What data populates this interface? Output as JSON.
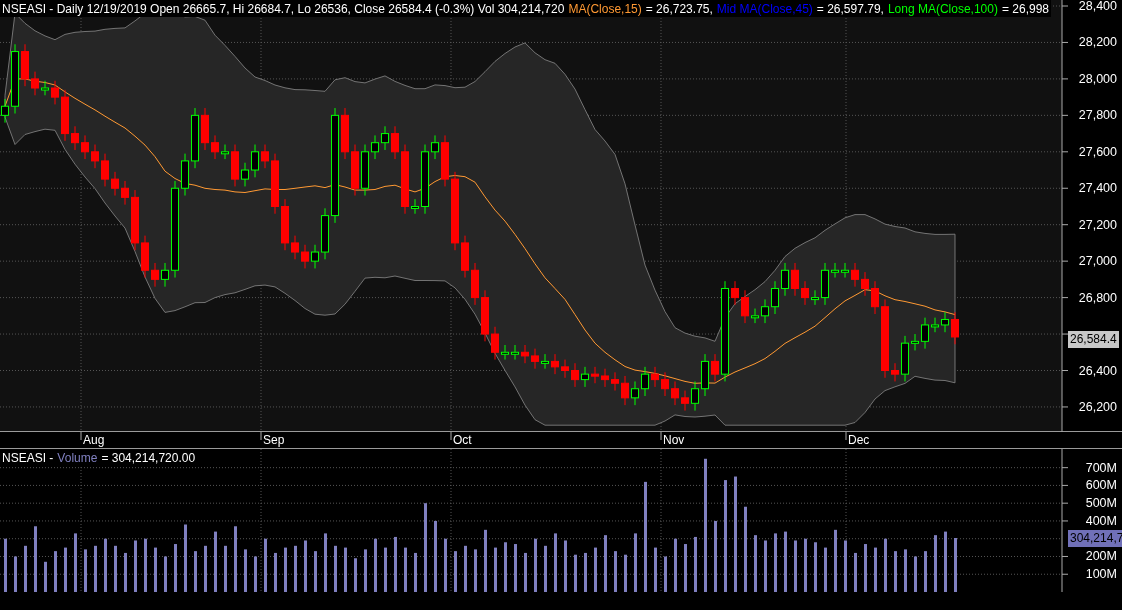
{
  "price_panel": {
    "header": [
      {
        "text": "NSEASI - Daily 12/19/2019 Open 26665.7, Hi 26684.7, Lo 26536, Close 26584.4 (-0.3%) Vol 304,214,720",
        "color": "#ffffff"
      },
      {
        "text": "MA(Close,15)",
        "color": "#ff9933"
      },
      {
        "text": "= 26,723.75,",
        "color": "#ffffff"
      },
      {
        "text": "Mid MA(Close,45)",
        "color": "#0000ff"
      },
      {
        "text": "= 26,597.79,",
        "color": "#ffffff"
      },
      {
        "text": "Long MA(Close,100)",
        "color": "#00ff00"
      },
      {
        "text": "= 26,998",
        "color": "#ffffff"
      }
    ],
    "last_price_tag": "26,584.4",
    "y_axis_labels": [
      "28,400",
      "28,200",
      "28,000",
      "27,800",
      "27,600",
      "27,400",
      "27,200",
      "27,000",
      "26,800",
      "26,400",
      "26,200"
    ],
    "x_axis_labels": [
      "Aug",
      "Sep",
      "Oct",
      "Nov",
      "Dec"
    ]
  },
  "volume_panel": {
    "title_prefix": "NSEASI -",
    "title_value": "= 304,214,720.00",
    "last_volume_tag": "304,214,7",
    "chart_data": {
      "type": "bar",
      "ylim": [
        0,
        760
      ],
      "grid": true,
      "categories": [
        null,
        null,
        null,
        null,
        null,
        null,
        null,
        null,
        null,
        null,
        null,
        null,
        null,
        null,
        null,
        null,
        null,
        null,
        null,
        null,
        null,
        null,
        null,
        null,
        null,
        null,
        null,
        null,
        null,
        null,
        null,
        null,
        null,
        null,
        null,
        null,
        null,
        null,
        null,
        null,
        null,
        null,
        null,
        null,
        null,
        null,
        null,
        null,
        null,
        null,
        null,
        null,
        null,
        null,
        null,
        null,
        null,
        null,
        null,
        null,
        null,
        null,
        null,
        null,
        null,
        null,
        null,
        null,
        null,
        null,
        null,
        null,
        null,
        null,
        null,
        null,
        null,
        null,
        null,
        null,
        null,
        null,
        null,
        null,
        null,
        null,
        null,
        null,
        null,
        null,
        null,
        null,
        null,
        null,
        null,
        null,
        null,
        null,
        null,
        null,
        null,
        null,
        null,
        null,
        null,
        null
      ],
      "yticks": [
        {
          "value": 100,
          "label": "100M"
        },
        {
          "value": 200,
          "label": "200M"
        },
        {
          "value": 400,
          "label": "400M"
        },
        {
          "value": 500,
          "label": "500M"
        },
        {
          "value": 600,
          "label": "600M"
        },
        {
          "value": 700,
          "label": "700M"
        }
      ],
      "series": [
        {
          "name": "Volume",
          "color": "#8080c0",
          "values": [
            300,
            200,
            260,
            370,
            170,
            230,
            250,
            330,
            240,
            260,
            300,
            260,
            220,
            290,
            300,
            250,
            200,
            270,
            380,
            230,
            260,
            340,
            260,
            370,
            240,
            200,
            300,
            220,
            250,
            260,
            290,
            230,
            330,
            260,
            250,
            190,
            240,
            300,
            250,
            310,
            250,
            220,
            500,
            400,
            300,
            230,
            260,
            240,
            350,
            250,
            280,
            270,
            220,
            300,
            260,
            330,
            290,
            210,
            220,
            250,
            320,
            230,
            210,
            330,
            620,
            250,
            200,
            300,
            270,
            310,
            750,
            400,
            630,
            650,
            480,
            320,
            290,
            330,
            340,
            290,
            300,
            280,
            250,
            350,
            290,
            220,
            270,
            250,
            300,
            230,
            240,
            200,
            230,
            320,
            340,
            304,
            null,
            null,
            null,
            null,
            null,
            null,
            null,
            null,
            null,
            null
          ]
        }
      ]
    }
  }
}
